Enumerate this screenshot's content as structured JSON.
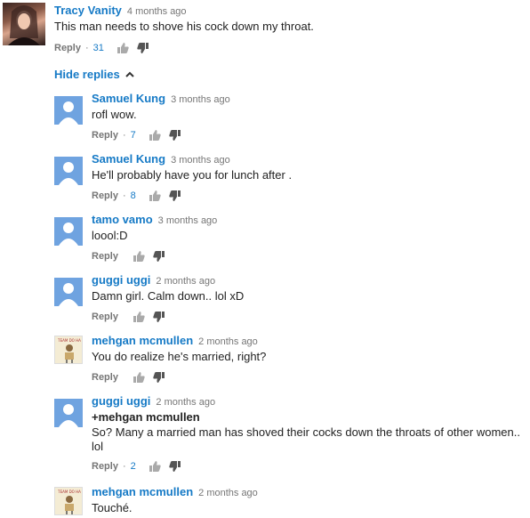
{
  "top_comment": {
    "author": "Tracy Vanity",
    "time": "4 months ago",
    "text": "This man needs to shove his cock down my throat.",
    "reply_label": "Reply",
    "separator": "·",
    "likes": "31",
    "avatar_icon": "user-photo"
  },
  "hide_replies_label": "Hide replies",
  "replies": [
    {
      "author": "Samuel Kung",
      "time": "3 months ago",
      "text": "rofl wow.",
      "reply_label": "Reply",
      "separator": "·",
      "likes": "7",
      "avatar_icon": "default-user-icon"
    },
    {
      "author": "Samuel Kung",
      "time": "3 months ago",
      "text": "He'll probably have you for lunch after .",
      "reply_label": "Reply",
      "separator": "·",
      "likes": "8",
      "avatar_icon": "default-user-icon"
    },
    {
      "author": "tamo vamo",
      "time": "3 months ago",
      "text": "loool:D",
      "reply_label": "Reply",
      "avatar_icon": "default-user-icon"
    },
    {
      "author": "guggi uggi",
      "time": "2 months ago",
      "text": "Damn girl. Calm down.. lol xD",
      "reply_label": "Reply",
      "avatar_icon": "default-user-icon"
    },
    {
      "author": "mehgan mcmullen",
      "time": "2 months ago",
      "text": "You do realize he's married, right?",
      "reply_label": "Reply",
      "avatar_icon": "sketch-avatar",
      "avatar_caption": "TEAM DO HA"
    },
    {
      "author": "guggi uggi",
      "time": "2 months ago",
      "mention": "+mehgan mcmullen",
      "text": "So? Many a married man has shoved their cocks down the throats of other women.. lol",
      "reply_label": "Reply",
      "separator": "·",
      "likes": "2",
      "avatar_icon": "default-user-icon"
    },
    {
      "author": "mehgan mcmullen",
      "time": "2 months ago",
      "text": "Touché.",
      "avatar_icon": "sketch-avatar",
      "avatar_caption": "TEAM DO HA"
    }
  ],
  "colors": {
    "link": "#167ac6",
    "muted": "#767676",
    "text": "#222222",
    "default_avatar": "#6fa3e0"
  }
}
